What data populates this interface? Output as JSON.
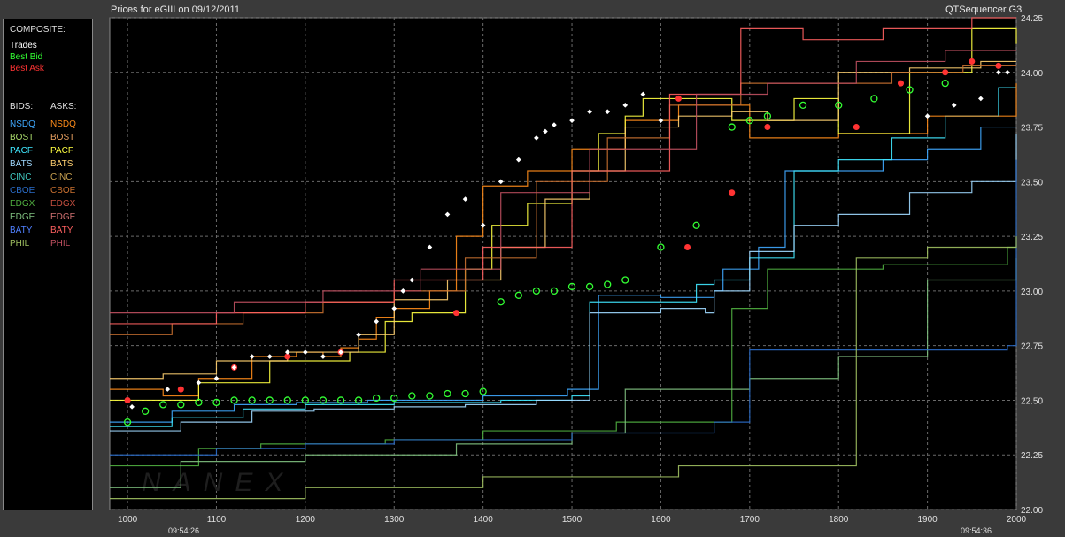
{
  "header": {
    "title": "Prices for  eGIII  on  09/12/2011",
    "app_name": "QTSequencer G3"
  },
  "legend": {
    "composite_label": "COMPOSITE:",
    "items": [
      {
        "label": "Trades",
        "color": "#ffffff"
      },
      {
        "label": "Best Bid",
        "color": "#33ff33"
      },
      {
        "label": "Best Ask",
        "color": "#ff3333"
      }
    ],
    "bids_label": "BIDS:",
    "asks_label": "ASKS:",
    "exchanges": [
      {
        "bid": "NSDQ",
        "ask": "NSDQ",
        "bid_color": "#3fa9ff",
        "ask_color": "#ff8c1a"
      },
      {
        "bid": "BOST",
        "ask": "BOST",
        "bid_color": "#a8d86a",
        "ask_color": "#e8a060"
      },
      {
        "bid": "PACF",
        "ask": "PACF",
        "bid_color": "#40e8ff",
        "ask_color": "#ffff40"
      },
      {
        "bid": "BATS",
        "ask": "BATS",
        "bid_color": "#9fd8ff",
        "ask_color": "#ffd070"
      },
      {
        "bid": "CINC",
        "ask": "CINC",
        "bid_color": "#40c8c0",
        "ask_color": "#c8a050"
      },
      {
        "bid": "CBOE",
        "ask": "CBOE",
        "bid_color": "#2a6cc8",
        "ask_color": "#c87030"
      },
      {
        "bid": "EDGX",
        "ask": "EDGX",
        "bid_color": "#50b040",
        "ask_color": "#c85040"
      },
      {
        "bid": "EDGE",
        "ask": "EDGE",
        "bid_color": "#80c080",
        "ask_color": "#d07070"
      },
      {
        "bid": "BATY",
        "ask": "BATY",
        "bid_color": "#5080ff",
        "ask_color": "#ff6060"
      },
      {
        "bid": "PHIL",
        "ask": "PHIL",
        "bid_color": "#a0c060",
        "ask_color": "#c05060"
      }
    ]
  },
  "watermark": "NANEX",
  "time_labels": {
    "start": "09:54:26",
    "end": "09:54:36"
  },
  "chart_data": {
    "type": "line",
    "title": "Prices for  eGIII  on  09/12/2011",
    "xlabel": "",
    "ylabel": "",
    "xlim": [
      980,
      2000
    ],
    "ylim": [
      22.0,
      24.25
    ],
    "x_ticks": [
      1000,
      1100,
      1200,
      1300,
      1400,
      1500,
      1600,
      1700,
      1800,
      1900,
      2000
    ],
    "y_ticks": [
      "22.00",
      "22.25",
      "22.50",
      "22.75",
      "23.00",
      "23.25",
      "23.50",
      "23.75",
      "24.00",
      "24.25"
    ],
    "grid": true,
    "series": [
      {
        "name": "NSDQ",
        "side": "bid",
        "color": "#3fa9ff",
        "x": [
          980,
          1050,
          1120,
          1190,
          1270,
          1400,
          1495,
          1530,
          1600,
          1660,
          1670,
          1710,
          1740,
          1790,
          1850,
          1900,
          1960,
          2000
        ],
        "y": [
          22.4,
          22.45,
          22.48,
          22.49,
          22.5,
          22.52,
          22.55,
          22.98,
          22.97,
          23.0,
          23.1,
          23.2,
          23.55,
          23.55,
          23.6,
          23.65,
          23.75,
          23.75
        ]
      },
      {
        "name": "PACF",
        "side": "bid",
        "color": "#40e8ff",
        "x": [
          980,
          1050,
          1130,
          1200,
          1300,
          1420,
          1500,
          1520,
          1610,
          1640,
          1660,
          1700,
          1750,
          1800,
          1860,
          1920,
          1980,
          2000
        ],
        "y": [
          22.38,
          22.42,
          22.46,
          22.48,
          22.49,
          22.5,
          22.52,
          22.95,
          22.95,
          23.03,
          23.05,
          23.15,
          23.55,
          23.6,
          23.7,
          23.8,
          23.93,
          23.93
        ]
      },
      {
        "name": "BATS",
        "side": "bid",
        "color": "#9fd8ff",
        "x": [
          980,
          1060,
          1140,
          1210,
          1300,
          1380,
          1460,
          1520,
          1600,
          1650,
          1660,
          1700,
          1750,
          1800,
          1880,
          1950,
          2000
        ],
        "y": [
          22.36,
          22.4,
          22.45,
          22.46,
          22.47,
          22.48,
          22.5,
          22.9,
          22.92,
          22.9,
          23.0,
          23.18,
          23.3,
          23.35,
          23.45,
          23.5,
          23.72
        ]
      },
      {
        "name": "EDGX",
        "side": "bid",
        "color": "#50b040",
        "x": [
          980,
          1080,
          1150,
          1290,
          1400,
          1550,
          1680,
          1720,
          1850,
          1990,
          2000
        ],
        "y": [
          22.2,
          22.28,
          22.3,
          22.32,
          22.36,
          22.4,
          22.92,
          23.1,
          23.12,
          23.2,
          23.2
        ]
      },
      {
        "name": "EDGE",
        "side": "bid",
        "color": "#80c080",
        "x": [
          980,
          1060,
          1200,
          1370,
          1500,
          1560,
          1700,
          1800,
          1900,
          2000
        ],
        "y": [
          22.1,
          22.22,
          22.25,
          22.3,
          22.35,
          22.55,
          22.6,
          22.7,
          23.05,
          23.15
        ]
      },
      {
        "name": "CBOE",
        "side": "bid",
        "color": "#2a6cc8",
        "x": [
          980,
          1100,
          1200,
          1300,
          1500,
          1660,
          1700,
          1880,
          1990,
          2000
        ],
        "y": [
          22.25,
          22.28,
          22.3,
          22.32,
          22.35,
          22.4,
          22.73,
          22.73,
          22.75,
          23.6
        ]
      },
      {
        "name": "PHIL",
        "side": "bid",
        "color": "#a0c060",
        "x": [
          980,
          1200,
          1400,
          1620,
          1820,
          1900,
          2000
        ],
        "y": [
          22.05,
          22.1,
          22.15,
          22.2,
          23.15,
          23.2,
          23.25
        ]
      },
      {
        "name": "NSDQ",
        "side": "ask",
        "color": "#ff8c1a",
        "x": [
          980,
          1040,
          1080,
          1140,
          1190,
          1220,
          1240,
          1260,
          1280,
          1300,
          1340,
          1370,
          1400,
          1450,
          1500,
          1560,
          1620,
          1700,
          1800,
          1900,
          2000
        ],
        "y": [
          22.55,
          22.52,
          22.6,
          22.7,
          22.72,
          22.7,
          22.74,
          22.78,
          22.88,
          22.92,
          23.0,
          23.25,
          23.48,
          23.55,
          23.65,
          23.78,
          23.85,
          23.7,
          23.72,
          23.8,
          23.95
        ]
      },
      {
        "name": "PACF",
        "side": "ask",
        "color": "#ffff40",
        "x": [
          980,
          1080,
          1160,
          1250,
          1290,
          1320,
          1380,
          1410,
          1450,
          1500,
          1530,
          1560,
          1580,
          1620,
          1680,
          1750,
          1800,
          1880,
          1950,
          2000
        ],
        "y": [
          22.5,
          22.58,
          22.68,
          22.72,
          22.86,
          22.9,
          23.1,
          23.3,
          23.4,
          23.55,
          23.72,
          23.8,
          23.88,
          23.88,
          23.78,
          23.88,
          23.72,
          24.0,
          24.2,
          24.13
        ]
      },
      {
        "name": "BATS",
        "side": "ask",
        "color": "#ffd070",
        "x": [
          980,
          1040,
          1100,
          1180,
          1260,
          1300,
          1360,
          1420,
          1470,
          1520,
          1560,
          1620,
          1680,
          1720,
          1800,
          1880,
          1960,
          2000
        ],
        "y": [
          22.6,
          22.62,
          22.68,
          22.72,
          22.8,
          22.96,
          23.05,
          23.2,
          23.42,
          23.55,
          23.75,
          23.8,
          23.82,
          23.78,
          24.0,
          24.02,
          24.05,
          24.05
        ]
      },
      {
        "name": "CBOE",
        "side": "ask",
        "color": "#c87030",
        "x": [
          980,
          1050,
          1130,
          1220,
          1300,
          1380,
          1460,
          1540,
          1610,
          1690,
          1780,
          1860,
          1940,
          2000
        ],
        "y": [
          22.8,
          22.85,
          22.9,
          22.95,
          23.0,
          23.15,
          23.5,
          23.7,
          23.85,
          23.95,
          23.95,
          24.0,
          24.03,
          24.03
        ]
      },
      {
        "name": "BATY",
        "side": "ask",
        "color": "#ff6060",
        "x": [
          980,
          1100,
          1200,
          1300,
          1400,
          1500,
          1610,
          1690,
          1760,
          1850,
          1950,
          2000
        ],
        "y": [
          22.85,
          22.9,
          22.95,
          23.05,
          23.2,
          23.55,
          23.9,
          24.2,
          24.15,
          24.2,
          24.25,
          24.25
        ]
      },
      {
        "name": "PHIL",
        "side": "ask",
        "color": "#c05060",
        "x": [
          980,
          1120,
          1220,
          1330,
          1420,
          1520,
          1640,
          1720,
          1820,
          1920,
          2000
        ],
        "y": [
          22.9,
          22.95,
          23.0,
          23.1,
          23.45,
          23.65,
          23.9,
          23.95,
          24.05,
          24.1,
          24.1
        ]
      }
    ],
    "trades": {
      "name": "Trades",
      "color": "#ffffff",
      "x": [
        1005,
        1045,
        1080,
        1100,
        1120,
        1140,
        1160,
        1180,
        1200,
        1220,
        1240,
        1260,
        1280,
        1300,
        1310,
        1320,
        1340,
        1360,
        1380,
        1400,
        1420,
        1440,
        1460,
        1470,
        1480,
        1500,
        1520,
        1540,
        1560,
        1580,
        1600,
        1900,
        1930,
        1960,
        1980,
        1990
      ],
      "y": [
        22.47,
        22.55,
        22.58,
        22.6,
        22.65,
        22.7,
        22.7,
        22.72,
        22.72,
        22.7,
        22.72,
        22.8,
        22.86,
        22.92,
        23.0,
        23.05,
        23.2,
        23.35,
        23.42,
        23.3,
        23.5,
        23.6,
        23.7,
        23.73,
        23.76,
        23.78,
        23.82,
        23.82,
        23.85,
        23.9,
        23.78,
        23.8,
        23.85,
        23.88,
        24.0,
        24.0
      ]
    },
    "best_bid": {
      "name": "Best Bid",
      "color": "#33ff33",
      "x": [
        1000,
        1020,
        1040,
        1060,
        1080,
        1100,
        1120,
        1140,
        1160,
        1180,
        1200,
        1220,
        1240,
        1260,
        1280,
        1300,
        1320,
        1340,
        1360,
        1380,
        1400,
        1420,
        1440,
        1460,
        1480,
        1500,
        1520,
        1540,
        1560,
        1600,
        1640,
        1680,
        1700,
        1720,
        1760,
        1800,
        1840,
        1880,
        1920
      ],
      "y": [
        22.4,
        22.45,
        22.48,
        22.48,
        22.49,
        22.49,
        22.5,
        22.5,
        22.5,
        22.5,
        22.5,
        22.5,
        22.5,
        22.5,
        22.51,
        22.51,
        22.52,
        22.52,
        22.53,
        22.53,
        22.54,
        22.95,
        22.98,
        23.0,
        23.0,
        23.02,
        23.02,
        23.03,
        23.05,
        23.2,
        23.3,
        23.75,
        23.78,
        23.8,
        23.85,
        23.85,
        23.88,
        23.92,
        23.95
      ]
    },
    "best_ask": {
      "name": "Best Ask",
      "color": "#ff3333",
      "x": [
        1000,
        1060,
        1120,
        1180,
        1240,
        1370,
        1620,
        1630,
        1680,
        1720,
        1820,
        1870,
        1920,
        1950,
        1980
      ],
      "y": [
        22.5,
        22.55,
        22.65,
        22.7,
        22.72,
        22.9,
        23.88,
        23.2,
        23.45,
        23.75,
        23.75,
        23.95,
        24.0,
        24.05,
        24.03
      ]
    }
  }
}
